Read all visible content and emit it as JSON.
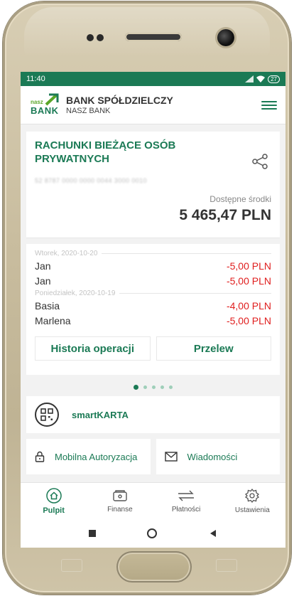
{
  "status_bar": {
    "time": "11:40",
    "battery": "27"
  },
  "app_bar": {
    "logo_small": "nasz",
    "logo_main": "BANK",
    "brand_title": "BANK SPÓŁDZIELCZY",
    "brand_subtitle": "NASZ BANK"
  },
  "account": {
    "title": "RACHUNKI BIEŻĄCE OSÓB PRYWATNYCH",
    "number": "52 8787 0000 0000 0044 3000 0010",
    "available_label": "Dostępne środki",
    "balance": "5 465,47 PLN"
  },
  "transactions": {
    "groups": [
      {
        "date": "Wtorek, 2020-10-20",
        "items": [
          {
            "name": "Jan",
            "amount": "-5,00 PLN"
          },
          {
            "name": "Jan",
            "amount": "-5,00 PLN"
          }
        ]
      },
      {
        "date": "Poniedziałek, 2020-10-19",
        "items": [
          {
            "name": "Basia",
            "amount": "-4,00 PLN"
          },
          {
            "name": "Marlena",
            "amount": "-5,00 PLN"
          }
        ]
      }
    ],
    "history_button": "Historia operacji",
    "transfer_button": "Przelew"
  },
  "pager": {
    "count": 5,
    "active": 0
  },
  "smartkarta": {
    "label": "smartKARTA"
  },
  "tiles": {
    "mobile_auth": "Mobilna Autoryzacja",
    "messages": "Wiadomości"
  },
  "bottom_nav": {
    "items": [
      {
        "label": "Pulpit",
        "icon": "home-icon",
        "active": true
      },
      {
        "label": "Finanse",
        "icon": "wallet-icon",
        "active": false
      },
      {
        "label": "Płatności",
        "icon": "transfer-arrows-icon",
        "active": false
      },
      {
        "label": "Ustawienia",
        "icon": "gear-icon",
        "active": false
      }
    ]
  },
  "colors": {
    "brand_green": "#1b7a55",
    "light_green": "#5aa628",
    "negative_red": "#e01e1e"
  }
}
